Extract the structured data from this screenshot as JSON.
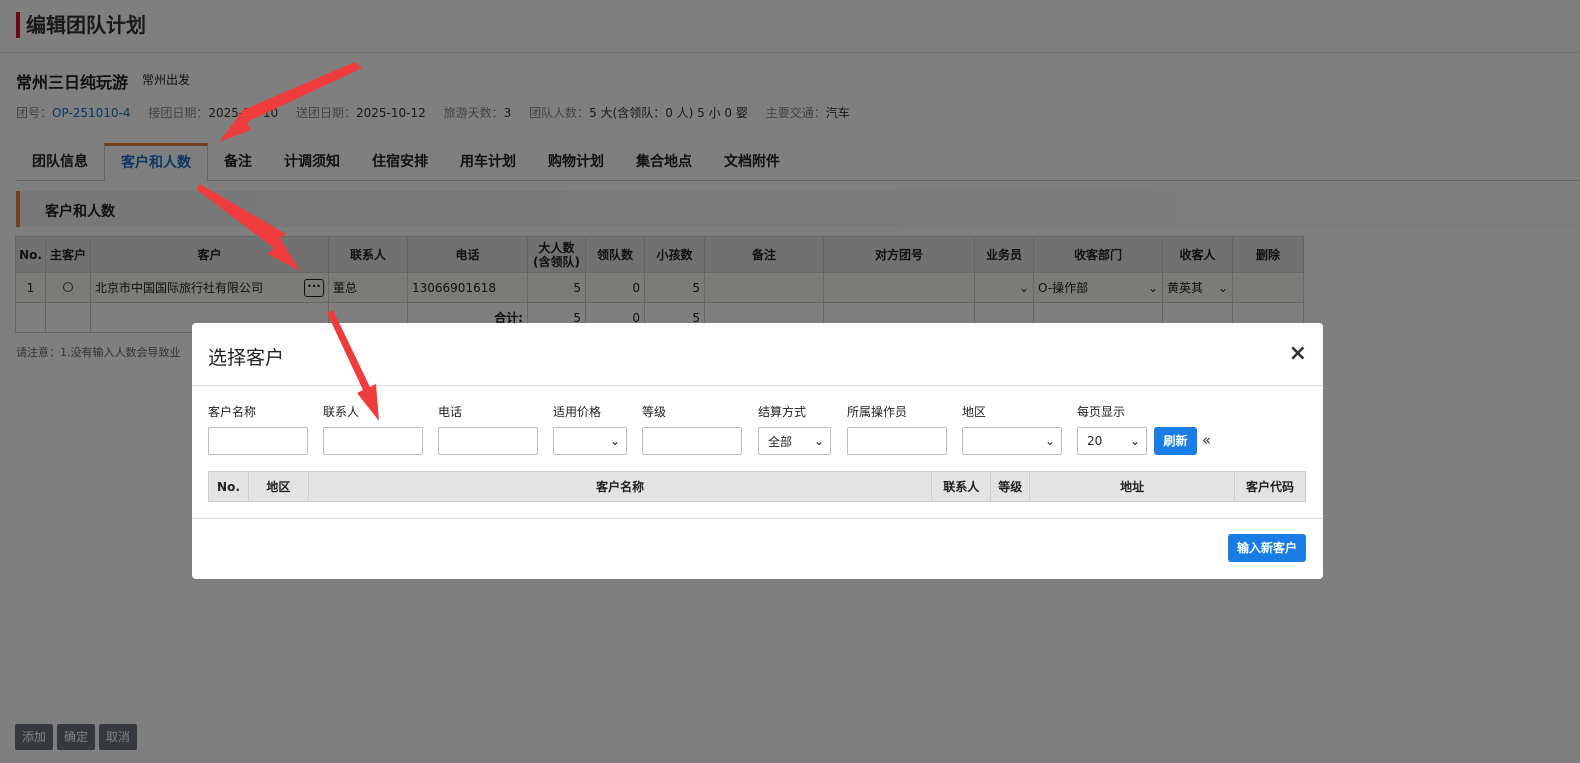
{
  "page": {
    "title": "编辑团队计划"
  },
  "tour": {
    "name": "常州三日纯玩游",
    "depart": "常州出发",
    "info": [
      {
        "label": "团号：",
        "value": "OP-251010-4"
      },
      {
        "label": "接团日期：",
        "value": "2025-10-10"
      },
      {
        "label": "送团日期：",
        "value": "2025-10-12"
      },
      {
        "label": "旅游天数：",
        "value": "3"
      },
      {
        "label": "团队人数：",
        "value": "5 大(含领队：0 人) 5 小 0 婴"
      },
      {
        "label": "主要交通：",
        "value": "汽车"
      }
    ]
  },
  "tabs": [
    "团队信息",
    "客户和人数",
    "备注",
    "计调须知",
    "住宿安排",
    "用车计划",
    "购物计划",
    "集合地点",
    "文档附件"
  ],
  "section": {
    "title": "客户和人数"
  },
  "customer_table": {
    "headers": [
      "No.",
      "主客户",
      "客户",
      "联系人",
      "电话",
      "大人数\n(含领队)",
      "领队数",
      "小孩数",
      "备注",
      "对方团号",
      "业务员",
      "收客部门",
      "收客人",
      "删除"
    ],
    "row": {
      "no": "1",
      "customer": "北京市中国国际旅行社有限公司",
      "contact": "董总",
      "phone": "13066901618",
      "adults": "5",
      "leaders": "0",
      "children": "5",
      "remark": "",
      "their_no": "",
      "salesman": "",
      "dept": "O-操作部",
      "receiver": "黄英其"
    },
    "total": {
      "label": "合计:",
      "adults": "5",
      "leaders": "0",
      "children": "5"
    }
  },
  "note": "请注意：1.没有输入人数会导致业",
  "footer_buttons": [
    "添加",
    "确定",
    "取消"
  ],
  "modal": {
    "title": "选择客户",
    "close": "×",
    "filters": {
      "name": {
        "label": "客户名称",
        "value": ""
      },
      "contact": {
        "label": "联系人",
        "value": ""
      },
      "phone": {
        "label": "电话",
        "value": ""
      },
      "price": {
        "label": "适用价格",
        "value": ""
      },
      "level": {
        "label": "等级",
        "value": ""
      },
      "settle": {
        "label": "结算方式",
        "value": "全部"
      },
      "operator": {
        "label": "所属操作员",
        "value": ""
      },
      "region": {
        "label": "地区",
        "value": ""
      },
      "per_page": {
        "label": "每页显示",
        "value": "20"
      }
    },
    "refresh_label": "刷新",
    "collapse_glyph": "«",
    "result_headers": [
      "No.",
      "地区",
      "客户名称",
      "联系人",
      "等级",
      "地址",
      "客户代码"
    ],
    "new_customer_label": "输入新客户"
  },
  "colors": {
    "accent": "#e8823c",
    "primary": "#1a7de6",
    "title_bar": "#c8102e",
    "annotation_arrow": "#f03c3c"
  },
  "icons": {
    "more": "ellipsis-icon",
    "dropdown": "chevron-down-icon",
    "close": "close-icon",
    "collapse": "double-chevron-left-icon"
  }
}
